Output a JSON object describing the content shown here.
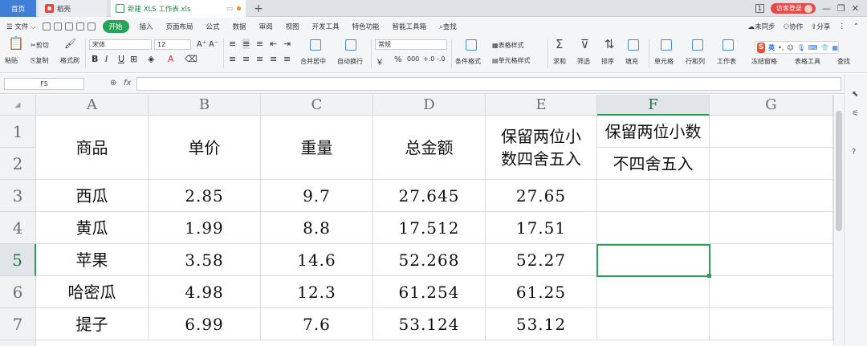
{
  "tabs": {
    "home": "首页",
    "daoke": "稻壳",
    "file": "新建 XLS 工作表.xls",
    "add": "+"
  },
  "window": {
    "num_badge": "1",
    "visitor": "访客登录",
    "minimize": "—",
    "restore": "❐",
    "close": "✕"
  },
  "menu": {
    "file": "文件",
    "items": [
      "开始",
      "插入",
      "页面布局",
      "公式",
      "数据",
      "审阅",
      "视图",
      "开发工具",
      "特色功能",
      "智能工具箱"
    ],
    "search": "查找",
    "right": [
      "未同步",
      "协作",
      "分享"
    ]
  },
  "toolbar": {
    "paste": "粘贴",
    "cut": "剪切",
    "copy": "复制",
    "format_painter": "格式刷",
    "font_name": "宋体",
    "font_size": "12",
    "font_grow": "A⁺",
    "font_shrink": "A⁻",
    "bold": "B",
    "italic": "I",
    "underline": "U",
    "merge_center": "合并居中",
    "wrap": "自动换行",
    "number_format": "常规",
    "currency": "￥",
    "percent": "%",
    "thousand": "000",
    "dec_inc": "+.0",
    "dec_dec": "-.0",
    "cond_format": "条件格式",
    "table_style": "表格样式",
    "cell_style": "单元格样式",
    "sum": "求和",
    "filter": "筛选",
    "sort": "排序",
    "fill": "填充",
    "cell": "单元格",
    "rowcol": "行和列",
    "worksheet": "工作表",
    "freeze": "冻结窗格",
    "table_tools": "表格工具",
    "find": "查找"
  },
  "ime": {
    "logo": "S",
    "lang": "英"
  },
  "formula": {
    "name_box": "F5",
    "fx": "fx",
    "content": ""
  },
  "sheet": {
    "columns": [
      "A",
      "B",
      "C",
      "D",
      "E",
      "F",
      "G"
    ],
    "rows": [
      "1",
      "2",
      "3",
      "4",
      "5",
      "6",
      "7"
    ],
    "selected_cell": "F5",
    "header": {
      "a": "商品",
      "b": "单价",
      "c": "重量",
      "d": "总金额",
      "e": "保留两位小数四舍五入",
      "f1": "保留两位小数",
      "f2": "不四舍五入"
    },
    "data": [
      {
        "a": "西瓜",
        "b": "2.85",
        "c": "9.7",
        "d": "27.645",
        "e": "27.65"
      },
      {
        "a": "黄瓜",
        "b": "1.99",
        "c": "8.8",
        "d": "17.512",
        "e": "17.51"
      },
      {
        "a": "苹果",
        "b": "3.58",
        "c": "14.6",
        "d": "52.268",
        "e": "52.27"
      },
      {
        "a": "哈密瓜",
        "b": "4.98",
        "c": "12.3",
        "d": "61.254",
        "e": "61.25"
      },
      {
        "a": "提子",
        "b": "6.99",
        "c": "7.6",
        "d": "53.124",
        "e": "53.12"
      }
    ]
  },
  "colors": {
    "accent_green": "#29a35a",
    "selection_green": "#1f7a3f",
    "tab_blue": "#3f7fd8",
    "visitor_red": "#e34b4b"
  }
}
